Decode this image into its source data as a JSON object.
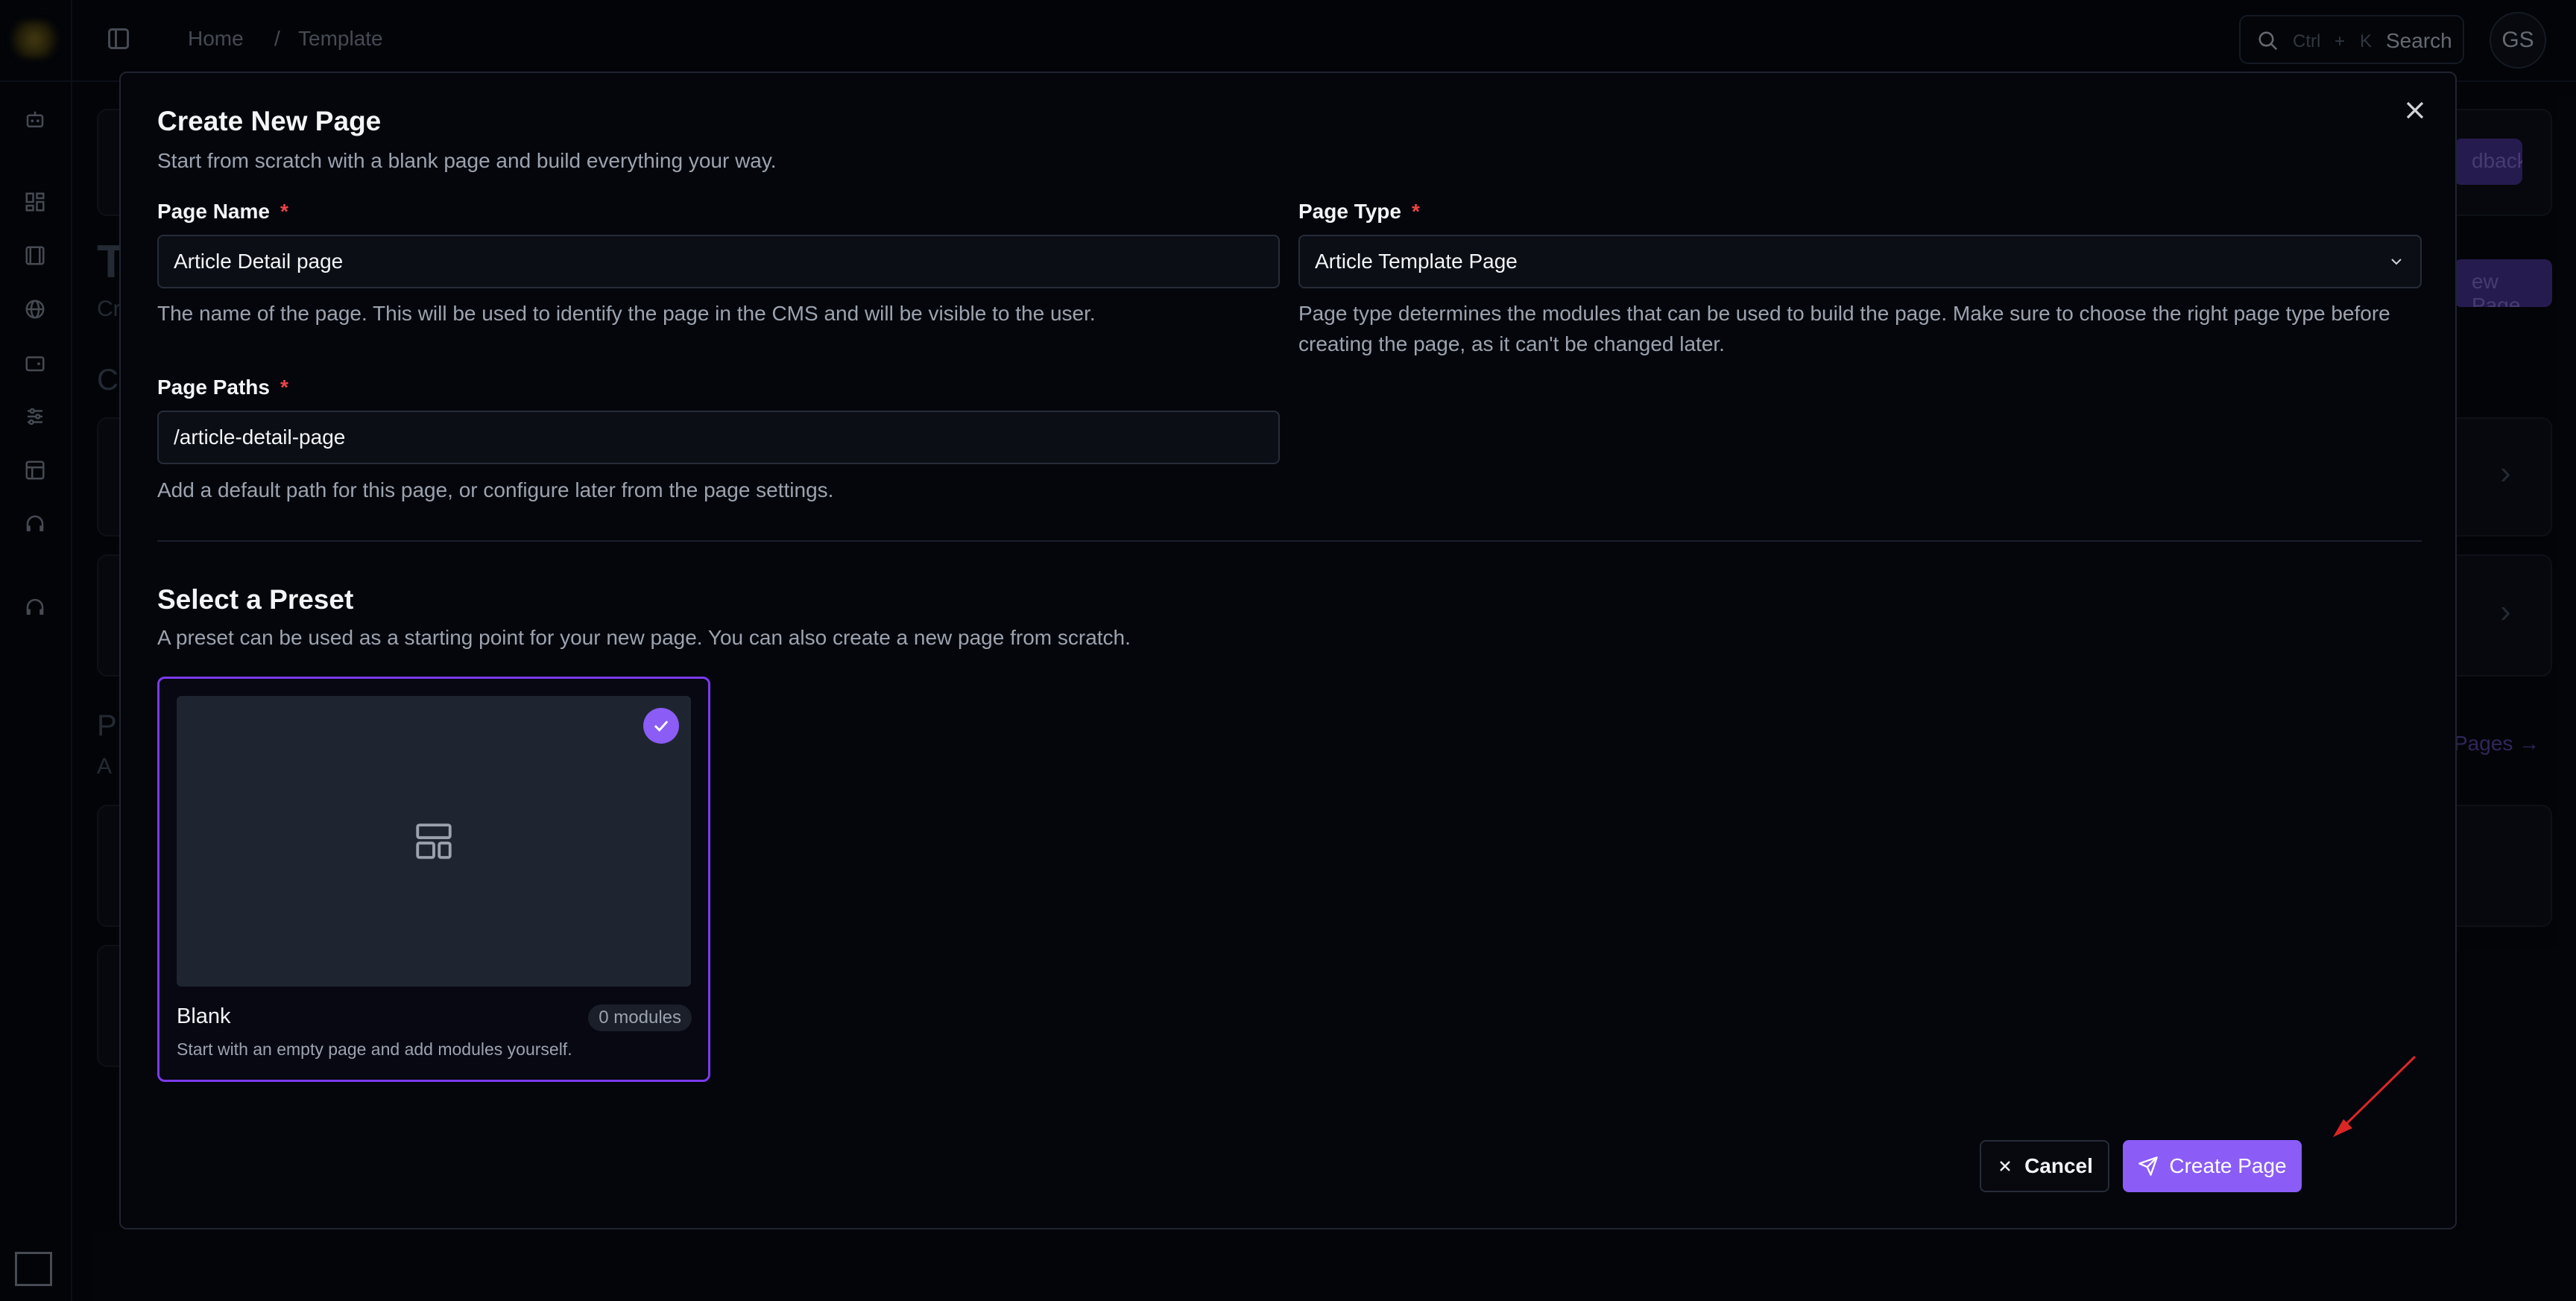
{
  "topbar": {
    "breadcrumb": [
      "Home",
      "Template"
    ],
    "breadcrumb_separator": "/",
    "search": {
      "shortcut_ctrl": "Ctrl",
      "shortcut_plus": "+",
      "shortcut_key": "K",
      "label": "Search"
    },
    "avatar_initials": "GS"
  },
  "background": {
    "title_char": "T",
    "subtitle_char": "Cr",
    "section1_char": "C",
    "section2_char": "P",
    "section2_sub_char": "A",
    "feedback_btn": "dback",
    "new_page_btn": "ew Page",
    "pages_link": "Pages"
  },
  "modal": {
    "title": "Create New Page",
    "subtitle": "Start from scratch with a blank page and build everything your way.",
    "page_name": {
      "label": "Page Name",
      "required_mark": "*",
      "value": "Article Detail page",
      "help": "The name of the page. This will be used to identify the page in the CMS and will be visible to the user."
    },
    "page_type": {
      "label": "Page Type",
      "required_mark": "*",
      "value": "Article Template Page",
      "help": "Page type determines the modules that can be used to build the page. Make sure to choose the right page type before creating the page, as it can't be changed later."
    },
    "page_paths": {
      "label": "Page Paths",
      "required_mark": "*",
      "value": "/article-detail-page",
      "help": "Add a default path for this page, or configure later from the page settings."
    },
    "preset_section": {
      "title": "Select a Preset",
      "subtitle": "A preset can be used as a starting point for your new page. You can also create a new page from scratch.",
      "presets": [
        {
          "name": "Blank",
          "badge": "0 modules",
          "description": "Start with an empty page and add modules yourself.",
          "selected": true
        }
      ]
    },
    "actions": {
      "cancel": "Cancel",
      "create": "Create Page"
    }
  },
  "colors": {
    "accent": "#8b5cf6",
    "required": "#ef4444",
    "annotation_arrow": "#dc2626"
  }
}
